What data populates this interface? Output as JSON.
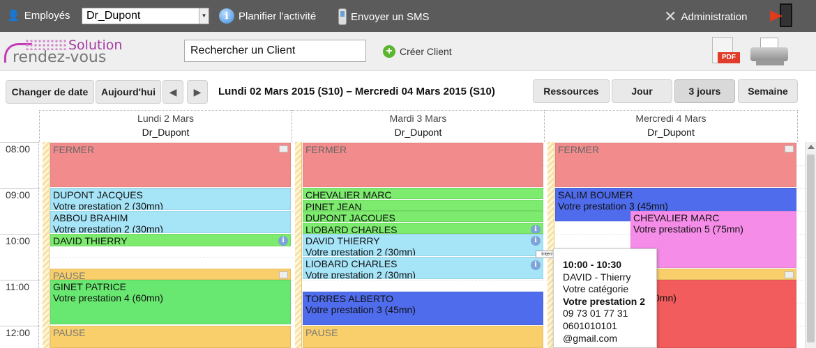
{
  "topbar": {
    "employees_label": "Employés",
    "employee_selected": "Dr_Dupont",
    "plan_label": "Planifier l'activité",
    "sms_label": "Envoyer un SMS",
    "admin_label": "Administration"
  },
  "logo": {
    "line1": "Solution",
    "line2": "rendez-vous"
  },
  "search": {
    "value": "Rechercher un Client"
  },
  "create_client": "Créer Client",
  "pdf_label": "PDF",
  "toolbar": {
    "change_date": "Changer de date",
    "today": "Aujourd'hui",
    "prev": "◀",
    "next": "▶",
    "range": "Lundi 02 Mars 2015 (S10) – Mercredi 04 Mars 2015 (S10)",
    "views": [
      "Ressources",
      "Jour",
      "3 jours",
      "Semaine"
    ],
    "active_view": "3 jours"
  },
  "columns": [
    {
      "day": "Lundi 2 Mars",
      "resource": "Dr_Dupont"
    },
    {
      "day": "Mardi 3 Mars",
      "resource": "Dr_Dupont"
    },
    {
      "day": "Mercredi 4 Mars",
      "resource": "Dr_Dupont"
    }
  ],
  "times": [
    "08:00",
    "09:00",
    "10:00",
    "11:00",
    "12:00"
  ],
  "events": {
    "mon": [
      {
        "title": "FERMER",
        "sub": ""
      },
      {
        "title": "DUPONT JACQUES",
        "sub": "Votre prestation 2 (30mn)"
      },
      {
        "title": "ABBOU BRAHIM",
        "sub": "Votre prestation 2 (30mn)"
      },
      {
        "title": "DAVID THIERRY",
        "sub": ""
      },
      {
        "title": "PAUSE",
        "sub": ""
      },
      {
        "title": "GINET PATRICE",
        "sub": "Votre prestation 4 (60mn)"
      },
      {
        "title": "PAUSE",
        "sub": ""
      }
    ],
    "tue": [
      {
        "title": "FERMER",
        "sub": ""
      },
      {
        "title": "CHEVALIER MARC",
        "sub": ""
      },
      {
        "title": "PINET JEAN",
        "sub": ""
      },
      {
        "title": "DUPONT JACQUES",
        "sub": ""
      },
      {
        "title": "LIOBARD CHARLES",
        "sub": ""
      },
      {
        "title": "DAVID THIERRY",
        "sub": "Votre prestation 2 (30mn)"
      },
      {
        "title": "LIOBARD CHARLES",
        "sub": "Votre prestation 2 (30mn)"
      },
      {
        "title": "TORRES ALBERTO",
        "sub": "Votre prestation 3 (45mn)"
      },
      {
        "title": "PAUSE",
        "sub": ""
      }
    ],
    "wed": [
      {
        "title": "FERMER",
        "sub": ""
      },
      {
        "title": "SALIM BOUMER",
        "sub": "Votre prestation 3 (45mn)"
      },
      {
        "title": "CHEVALIER MARC",
        "sub": "Votre prestation 5 (75mn)"
      },
      {
        "title": "",
        "sub": "0mn)"
      }
    ]
  },
  "tooltip_tag": "Internet",
  "popup": {
    "time": "10:00 - 10:30",
    "name": "DAVID - Thierry",
    "category": "Votre catégorie",
    "prestation": "Votre prestation 2",
    "phone1": "09 73 01 77 31",
    "phone2": "0601010101",
    "email": "@gmail.com"
  },
  "colors": {
    "topbar": "#5b5b5b",
    "closed": "#f28c8c",
    "booked_blue": "#a6e4f8",
    "booked_green": "#7ceb6e",
    "pause": "#f8cf6a",
    "royal_blue": "#4f6cec",
    "pink": "#f58ce8",
    "red": "#f25c5c"
  }
}
